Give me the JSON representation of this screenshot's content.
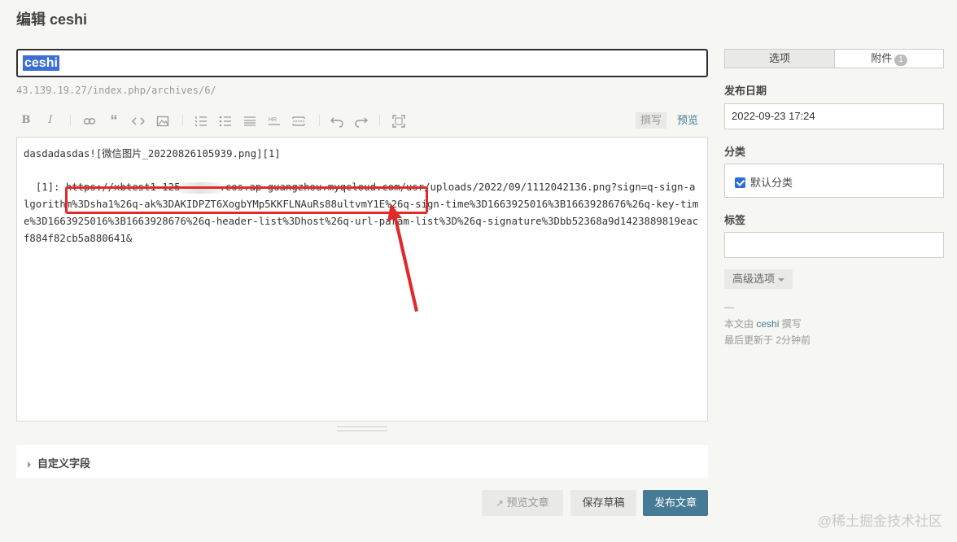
{
  "page": {
    "title": "编辑 ceshi"
  },
  "editor": {
    "title_value": "ceshi",
    "permalink": "43.139.19.27/index.php/archives/6/",
    "toolbar": {
      "write_tab": "撰写",
      "preview_tab": "预览"
    },
    "content_line1": "dasdadasdas![微信图片_20220826105939.png][1]",
    "url_prefix": "  [1]: https://xbtest1-125",
    "url_rest": ".cos.ap-guangzhou.myqcloud.com/usr/uploads/2022/09/1112042136.png?sign=q-sign-algorithm%3Dsha1%26q-ak%3DAKIDPZT6XogbYMp5KKFLNAuRs88ultvmY1E%26q-sign-time%3D1663925016%3B1663928676%26q-key-time%3D1663925016%3B1663928676%26q-header-list%3Dhost%26q-url-param-list%3D%26q-signature%3Dbb52368a9d1423889819eacf884f82cb5a880641&"
  },
  "custom_fields": {
    "label": "自定义字段"
  },
  "actions": {
    "preview": "预览文章",
    "save_draft": "保存草稿",
    "publish": "发布文章"
  },
  "sidebar": {
    "tabs": {
      "options": "选项",
      "attachments": "附件",
      "attachments_count": "1"
    },
    "date_label": "发布日期",
    "date_value": "2022-09-23 17:24",
    "category_label": "分类",
    "category_default": "默认分类",
    "tags_label": "标签",
    "advanced": "高级选项",
    "meta_dash": "—",
    "meta_author_prefix": "本文由",
    "meta_author": "ceshi",
    "meta_author_suffix": "撰写",
    "meta_updated": "最后更新于 2分钟前"
  },
  "watermark": "@稀土掘金技术社区",
  "colors": {
    "accent": "#467b96",
    "highlight": "#e02a2a",
    "selection": "#3b6fd4"
  }
}
